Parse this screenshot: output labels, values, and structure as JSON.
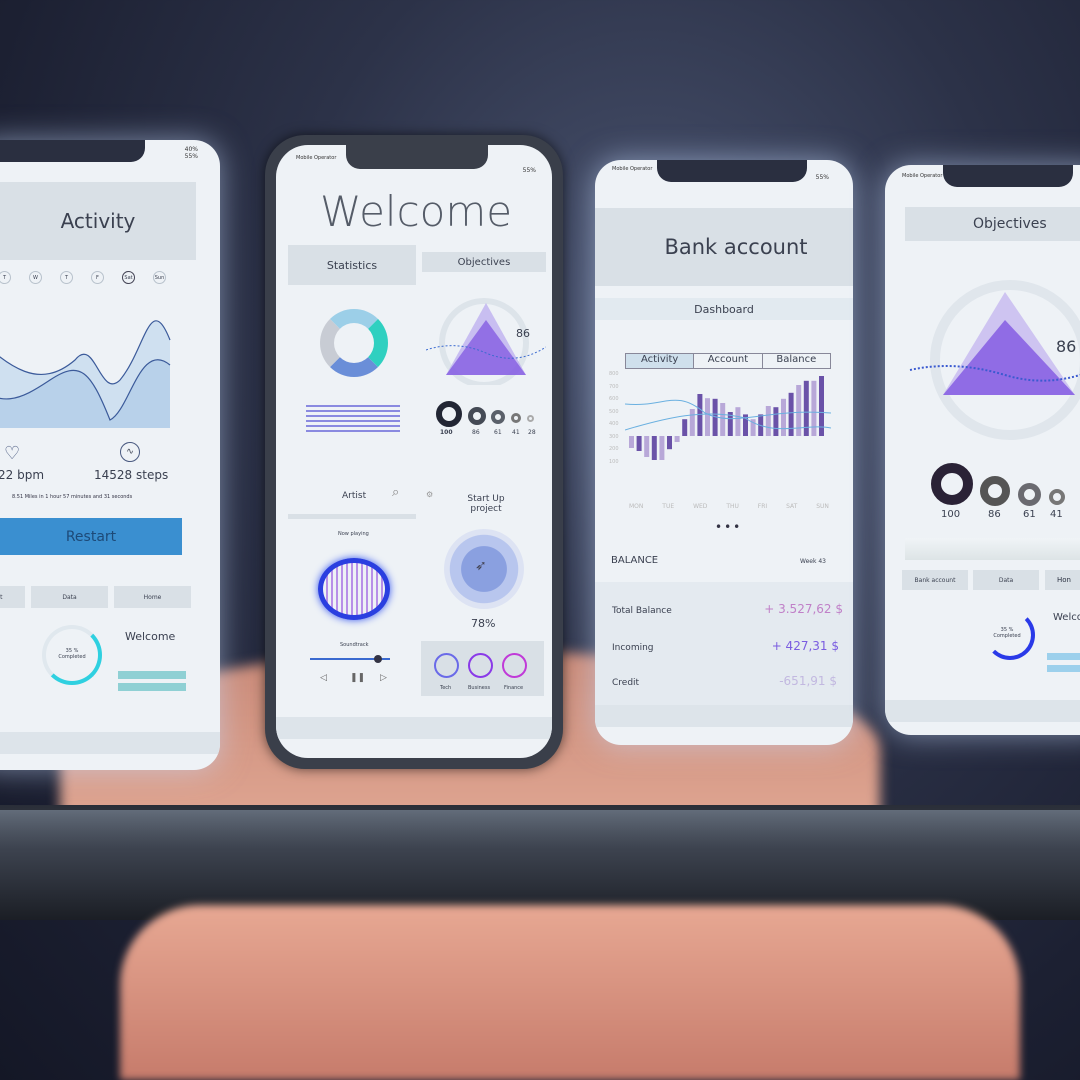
{
  "activity": {
    "title": "Activity",
    "days": [
      "T",
      "W",
      "T",
      "F",
      "Sat",
      "Sun"
    ],
    "bpm": "22 bpm",
    "steps": "14528 steps",
    "summary": "8.51 Miles in 1 hour 57 minutes and 31 seconds",
    "button": "Restart",
    "panels": [
      "unt",
      "Data",
      "Home"
    ],
    "completed": "35 % Completed",
    "welcome": "Welcome",
    "battery": "40%\n55%"
  },
  "welcome": {
    "operator": "Mobile Operator",
    "title": "Welcome",
    "statistics": "Statistics",
    "objectives": "Objectives",
    "peak": "86",
    "rings": [
      "100",
      "86",
      "61",
      "41",
      "28"
    ],
    "artist": "Artist",
    "now_playing": "Now playing",
    "soundtrack": "Soundtrack",
    "startup": "Start Up project",
    "startup_pct": "78%",
    "categories": [
      "Tech",
      "Business",
      "Finance"
    ],
    "battery": "55%"
  },
  "bank": {
    "operator": "Mobile Operator",
    "title": "Bank account",
    "dashboard": "Dashboard",
    "tabs": [
      "Activity",
      "Account",
      "Balance"
    ],
    "y_ticks": [
      "800",
      "700",
      "600",
      "500",
      "400",
      "300",
      "200",
      "100"
    ],
    "days": [
      "MON",
      "TUE",
      "WED",
      "THU",
      "FRI",
      "SAT",
      "SUN"
    ],
    "balance_label": "BALANCE",
    "week": "Week 43",
    "rows": [
      {
        "label": "Total Balance",
        "value": "+ 3.527,62 $",
        "color": "#c080c8"
      },
      {
        "label": "Incoming",
        "value": "+ 427,31 $",
        "color": "#7a5ce0"
      },
      {
        "label": "Credit",
        "value": "-651,91 $",
        "color": "#c2b8e0"
      }
    ],
    "battery": "55%"
  },
  "objectives": {
    "operator": "Mobile Operator",
    "title": "Objectives",
    "peak": "86",
    "rings": [
      "100",
      "86",
      "61",
      "41"
    ],
    "panels": [
      "Bank account",
      "Data",
      "Hon"
    ],
    "completed": "35 % Completed",
    "welcome": "Welco"
  },
  "colors": {
    "accent": "#3a8fd0",
    "purple": "#7b4fe0",
    "cyan": "#2fd0e0"
  }
}
